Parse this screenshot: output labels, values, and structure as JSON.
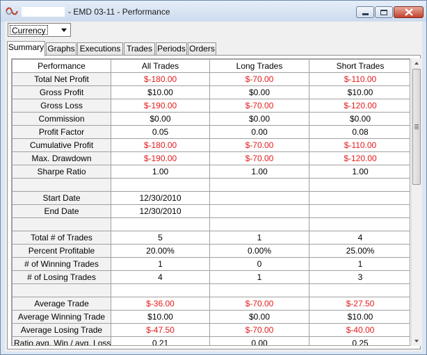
{
  "window": {
    "title": "- EMD 03-11 - Performance"
  },
  "toolbar": {
    "currency_selected": "Currency"
  },
  "tabs": [
    {
      "label": "Summary",
      "active": true
    },
    {
      "label": "Graphs",
      "active": false
    },
    {
      "label": "Executions",
      "active": false
    },
    {
      "label": "Trades",
      "active": false
    },
    {
      "label": "Periods",
      "active": false
    },
    {
      "label": "Orders",
      "active": false
    }
  ],
  "grid": {
    "headers": [
      "Performance",
      "All Trades",
      "Long Trades",
      "Short Trades"
    ],
    "rows": [
      {
        "label": "Total Net Profit",
        "all": "$-180.00",
        "long": "$-70.00",
        "short": "$-110.00",
        "negative": true
      },
      {
        "label": "Gross Profit",
        "all": "$10.00",
        "long": "$0.00",
        "short": "$10.00",
        "negative": false
      },
      {
        "label": "Gross Loss",
        "all": "$-190.00",
        "long": "$-70.00",
        "short": "$-120.00",
        "negative": true
      },
      {
        "label": "Commission",
        "all": "$0.00",
        "long": "$0.00",
        "short": "$0.00",
        "negative": false
      },
      {
        "label": "Profit Factor",
        "all": "0.05",
        "long": "0.00",
        "short": "0.08",
        "negative": false
      },
      {
        "label": "Cumulative Profit",
        "all": "$-180.00",
        "long": "$-70.00",
        "short": "$-110.00",
        "negative": true
      },
      {
        "label": "Max. Drawdown",
        "all": "$-190.00",
        "long": "$-70.00",
        "short": "$-120.00",
        "negative": true
      },
      {
        "label": "Sharpe Ratio",
        "all": "1.00",
        "long": "1.00",
        "short": "1.00",
        "negative": false
      },
      {
        "blank": true
      },
      {
        "label": "Start Date",
        "all": "12/30/2010",
        "long": "",
        "short": "",
        "negative": false,
        "left": true
      },
      {
        "label": "End Date",
        "all": "12/30/2010",
        "long": "",
        "short": "",
        "negative": false,
        "left": true
      },
      {
        "blank": true
      },
      {
        "label": "Total # of Trades",
        "all": "5",
        "long": "1",
        "short": "4",
        "negative": false
      },
      {
        "label": "Percent Profitable",
        "all": "20.00%",
        "long": "0.00%",
        "short": "25.00%",
        "negative": false
      },
      {
        "label": "# of Winning Trades",
        "all": "1",
        "long": "0",
        "short": "1",
        "negative": false
      },
      {
        "label": "# of Losing Trades",
        "all": "4",
        "long": "1",
        "short": "3",
        "negative": false
      },
      {
        "blank": true
      },
      {
        "label": "Average Trade",
        "all": "$-36.00",
        "long": "$-70.00",
        "short": "$-27.50",
        "negative": true
      },
      {
        "label": "Average Winning Trade",
        "all": "$10.00",
        "long": "$0.00",
        "short": "$10.00",
        "negative": false
      },
      {
        "label": "Average Losing Trade",
        "all": "$-47.50",
        "long": "$-70.00",
        "short": "$-40.00",
        "negative": true
      },
      {
        "label": "Ratio avg. Win / avg. Loss",
        "all": "0.21",
        "long": "0.00",
        "short": "0.25",
        "negative": false
      }
    ]
  },
  "colors": {
    "negative": "#e31b1b",
    "label_bg": "#f2f2f2",
    "window_frame": "#dbe6f4"
  }
}
